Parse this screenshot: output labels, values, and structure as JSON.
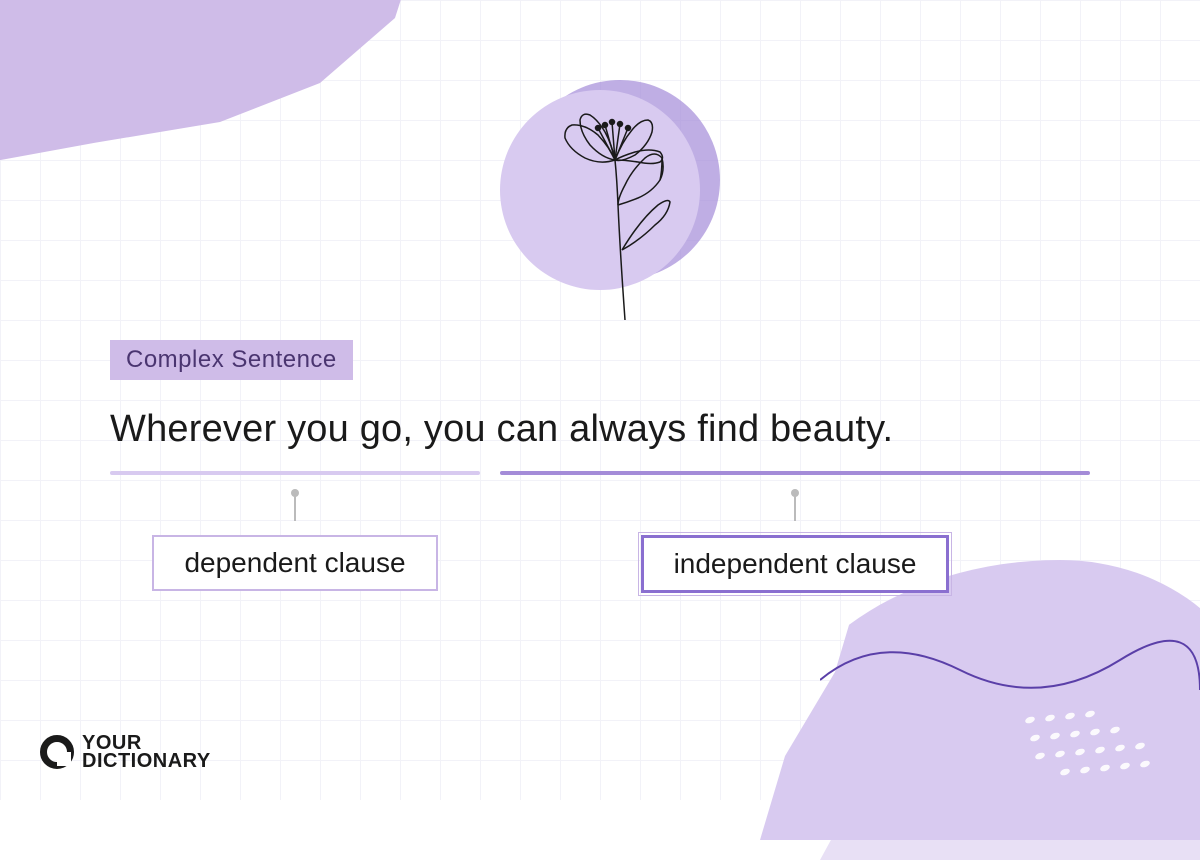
{
  "diagram": {
    "type": "complex-sentence",
    "badge_label": "Complex Sentence",
    "sentence": "Wherever you go, you can always find beauty.",
    "clauses": [
      {
        "type": "dependent",
        "text_span": "Wherever you go,",
        "label": "dependent clause"
      },
      {
        "type": "independent",
        "text_span": "you can always find beauty.",
        "label": "independent clause"
      }
    ]
  },
  "branding": {
    "logo_line1": "YOUR",
    "logo_line2": "DICTIONARY"
  },
  "colors": {
    "accent_light": "#d8caf0",
    "accent_mid": "#cfbce8",
    "accent_dark": "#a48cd8",
    "border_light": "#c8b5e5",
    "border_dark": "#8a6fd0",
    "text": "#1a1a1a"
  },
  "icons": {
    "center_illustration": "lily-flower"
  }
}
